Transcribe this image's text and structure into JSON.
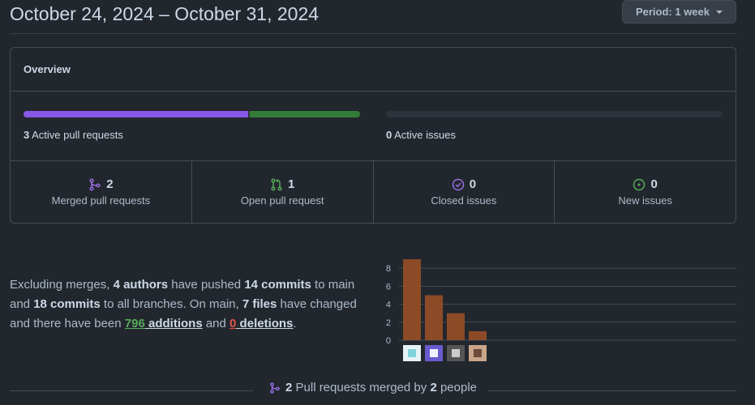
{
  "header": {
    "title": "October 24, 2024 – October 31, 2024",
    "period_label": "Period: 1 week"
  },
  "overview": {
    "heading": "Overview",
    "pull_requests": {
      "count": "3",
      "label": "Active pull requests",
      "merged_fraction": 0.667,
      "open_fraction": 0.333
    },
    "issues": {
      "count": "0",
      "label": "Active issues"
    },
    "stats": [
      {
        "value": "2",
        "label": "Merged pull requests",
        "icon": "git-merge-icon",
        "color": "#986ee2"
      },
      {
        "value": "1",
        "label": "Open pull request",
        "icon": "git-pull-request-icon",
        "color": "#57ab5a"
      },
      {
        "value": "0",
        "label": "Closed issues",
        "icon": "issue-closed-icon",
        "color": "#986ee2"
      },
      {
        "value": "0",
        "label": "New issues",
        "icon": "issue-opened-icon",
        "color": "#57ab5a"
      }
    ]
  },
  "summary": {
    "t1": "Excluding merges, ",
    "authors": "4 authors",
    "t2": " have pushed ",
    "commits_main": "14 commits",
    "t3": " to main and ",
    "commits_all": "18 commits",
    "t4": " to all branches. On main, ",
    "files": "7 files",
    "t5": " have changed and there have been ",
    "additions_num": "796",
    "additions_word": " additions",
    "t6": " and ",
    "deletions_num": "0",
    "deletions_word": " deletions",
    "t7": "."
  },
  "chart_data": {
    "type": "bar",
    "categories": [
      "author-1",
      "author-2",
      "author-3",
      "author-4"
    ],
    "values": [
      9,
      5,
      3,
      1
    ],
    "ylim": [
      0,
      9
    ],
    "yticks": [
      "0",
      "2",
      "4",
      "6",
      "8"
    ],
    "bar_color": "#8c4b26",
    "grid": true
  },
  "footer": {
    "count": "2",
    "t1": " Pull requests merged by ",
    "people": "2",
    "t2": " people"
  }
}
